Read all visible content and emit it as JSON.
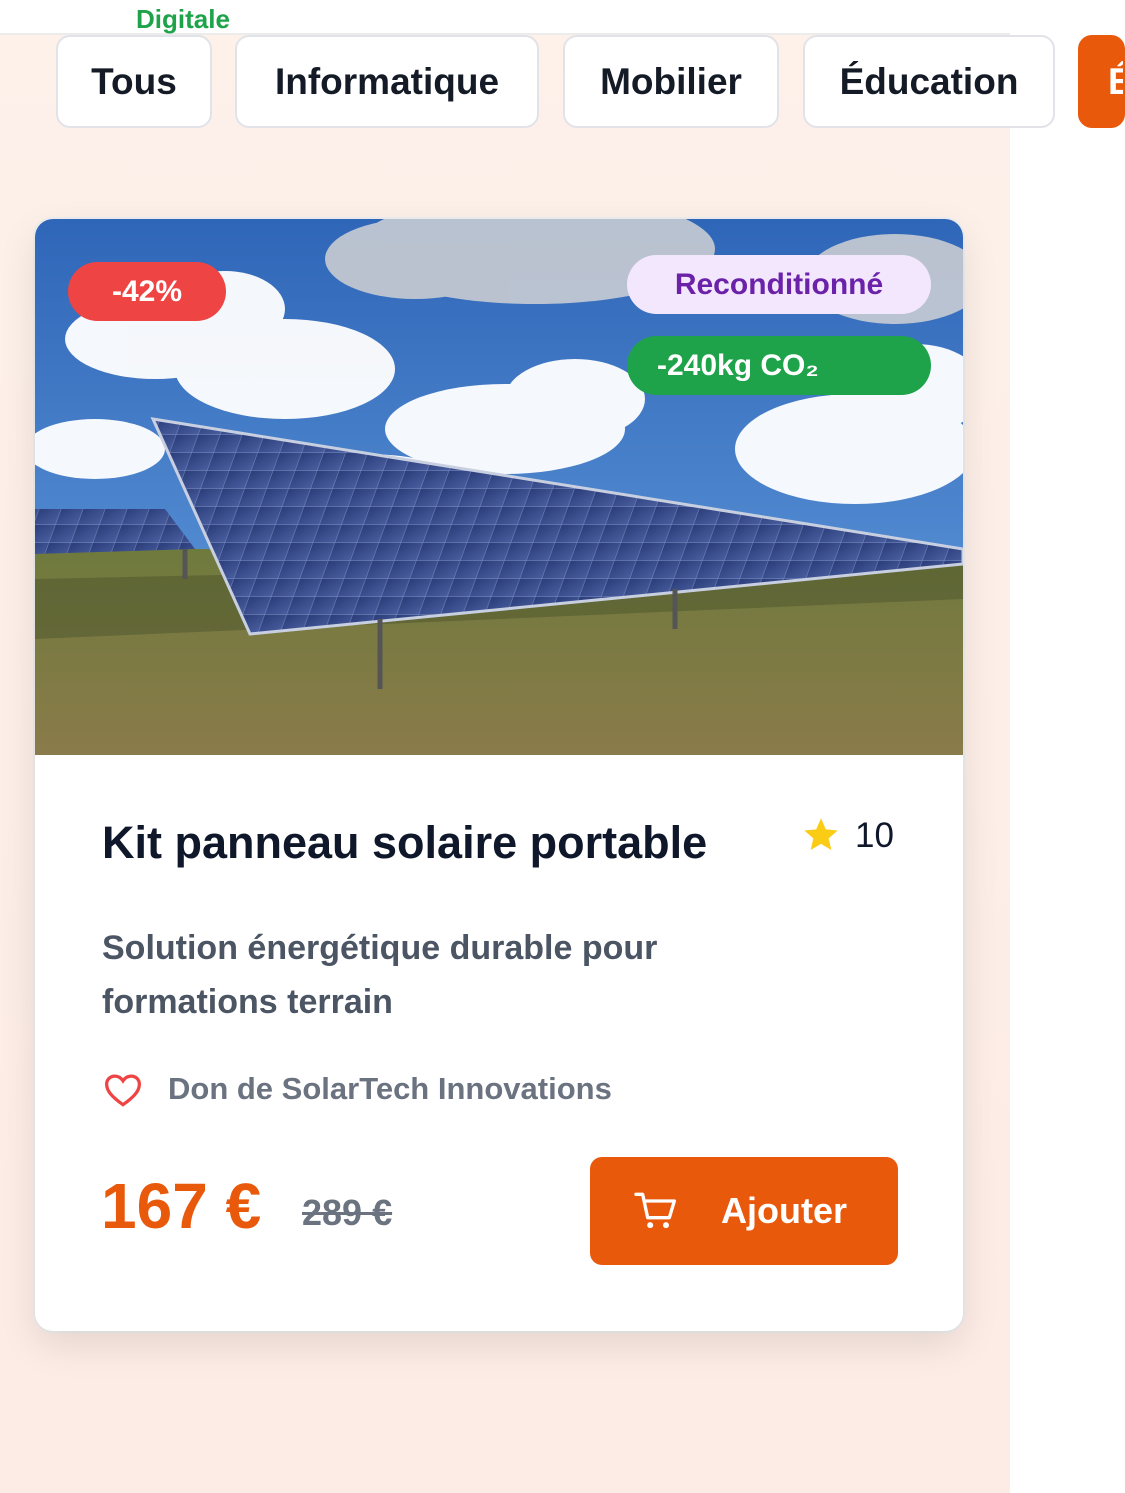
{
  "top_strip": {
    "text": "Digitale"
  },
  "filters": [
    {
      "label": "Tous",
      "active": false
    },
    {
      "label": "Informatique",
      "active": false
    },
    {
      "label": "Mobilier",
      "active": false
    },
    {
      "label": "Éducation",
      "active": false
    },
    {
      "label": "É",
      "active": true
    }
  ],
  "product": {
    "image_description_icon": "solar-panel-image",
    "badges": {
      "discount": "-42%",
      "condition": "Reconditionné",
      "co2": "-240kg CO₂"
    },
    "title": "Kit panneau solaire portable",
    "rating": "10",
    "description": "Solution énergétique durable pour formations terrain",
    "donor": "Don de SolarTech Innovations",
    "price": "167 €",
    "old_price": "289 €",
    "add_button_label": "Ajouter"
  },
  "colors": {
    "accent": "#e9590c",
    "discount_badge": "#ef4444",
    "refurb_badge_bg": "#f2e7fd",
    "refurb_badge_text": "#6b21a8",
    "co2_badge": "#1ea34a",
    "star": "#facc15"
  }
}
